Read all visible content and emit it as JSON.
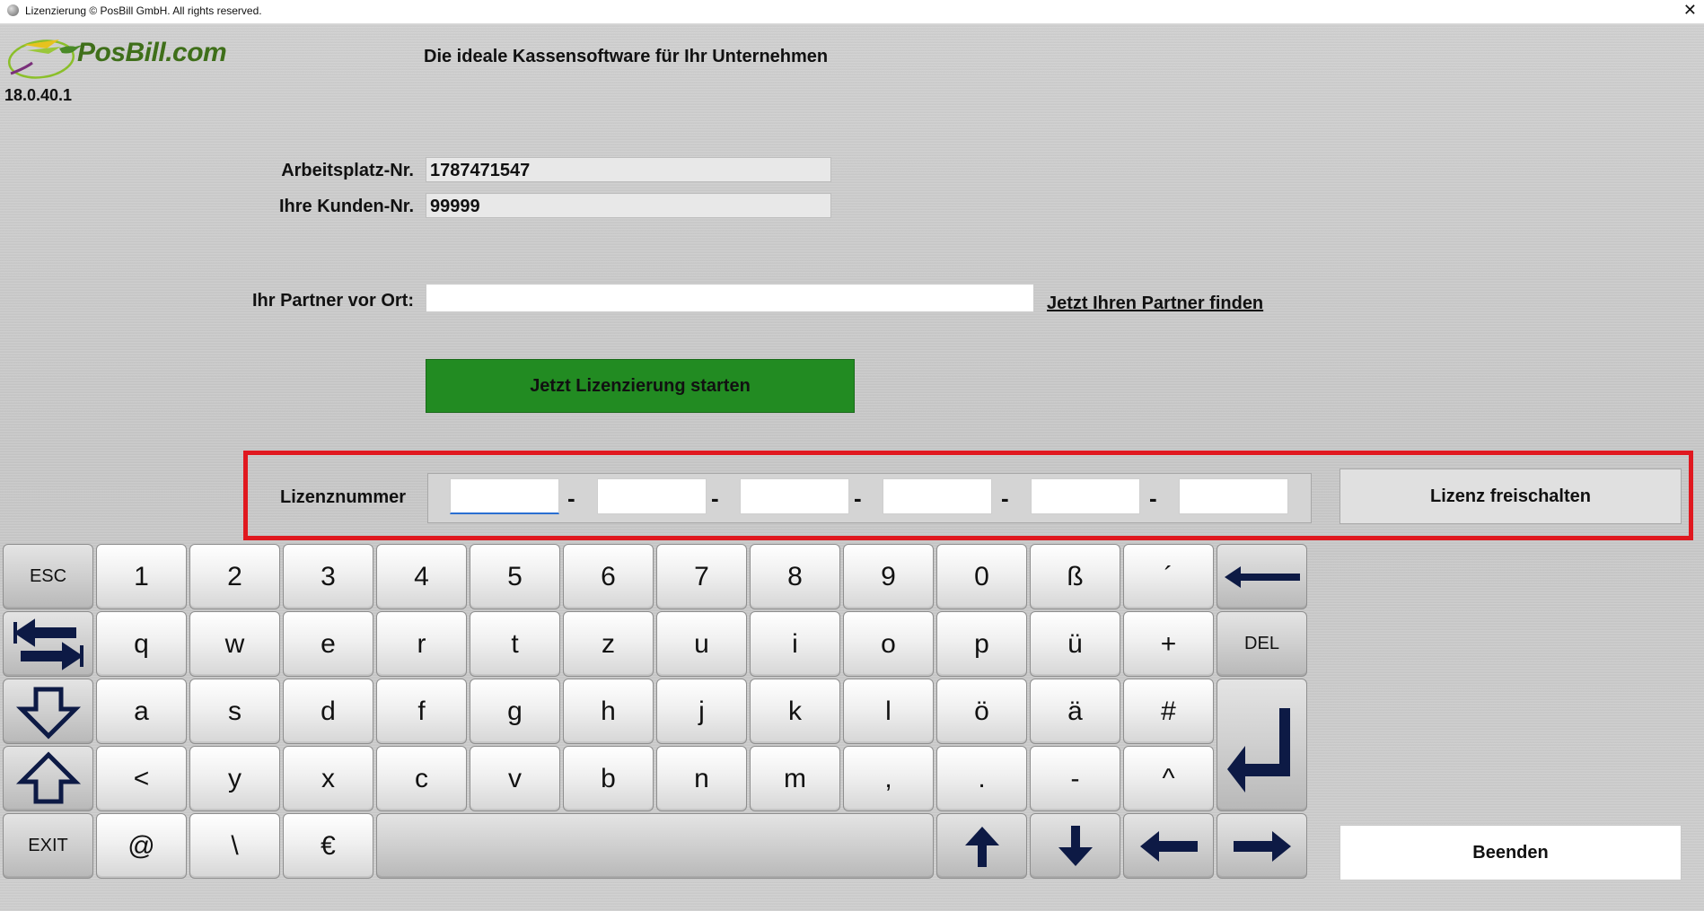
{
  "window": {
    "title": "Lizenzierung © PosBill GmbH. All rights reserved.",
    "close_glyph": "✕"
  },
  "header": {
    "brand": "PosBill.com",
    "version": "18.0.40.1",
    "tagline": "Die ideale Kassensoftware für Ihr Unternehmen"
  },
  "form": {
    "workstation_label": "Arbeitsplatz-Nr.",
    "workstation_value": "1787471547",
    "customer_label": "Ihre Kunden-Nr.",
    "customer_value": "99999",
    "partner_label": "Ihr Partner vor Ort:",
    "partner_value": "",
    "partner_link": "Jetzt Ihren Partner finden",
    "start_button": "Jetzt Lizenzierung starten"
  },
  "license": {
    "label": "Lizenznummer",
    "segments": [
      "",
      "",
      "",
      "",
      "",
      ""
    ],
    "separator": "-",
    "unlock_button": "Lizenz freischalten"
  },
  "keyboard": {
    "row1": [
      "ESC",
      "1",
      "2",
      "3",
      "4",
      "5",
      "6",
      "7",
      "8",
      "9",
      "0",
      "ß",
      "´",
      "backspace-icon"
    ],
    "row2": [
      "tab-icon",
      "q",
      "w",
      "e",
      "r",
      "t",
      "z",
      "u",
      "i",
      "o",
      "p",
      "ü",
      "+",
      "DEL"
    ],
    "row3": [
      "caps-down-icon",
      "a",
      "s",
      "d",
      "f",
      "g",
      "h",
      "j",
      "k",
      "l",
      "ö",
      "ä",
      "#",
      "enter-icon"
    ],
    "row4": [
      "shift-icon",
      "<",
      "y",
      "x",
      "c",
      "v",
      "b",
      "n",
      "m",
      ",",
      ".",
      "-",
      "^"
    ],
    "row5": [
      "EXIT",
      "@",
      "\\",
      "€",
      "space",
      "arrow-up-icon",
      "arrow-down-icon",
      "arrow-left-icon",
      "arrow-right-icon"
    ]
  },
  "footer": {
    "quit_button": "Beenden"
  },
  "colors": {
    "start_button_bg": "#228b22",
    "highlight_border": "#e0181f",
    "icon_color": "#0d1a45"
  }
}
